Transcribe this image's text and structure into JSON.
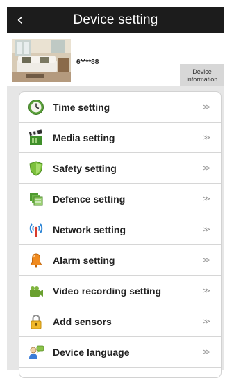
{
  "header": {
    "title": "Device setting",
    "back_glyph": "‹"
  },
  "device": {
    "id": "6****88",
    "info_label_line1": "Device",
    "info_label_line2": "information"
  },
  "menu": {
    "arrow_glyph": "≫",
    "items": [
      {
        "label": "Time setting",
        "icon": "clock-icon"
      },
      {
        "label": "Media setting",
        "icon": "clapperboard-icon"
      },
      {
        "label": "Safety setting",
        "icon": "shield-icon"
      },
      {
        "label": "Defence setting",
        "icon": "defence-icon"
      },
      {
        "label": "Network setting",
        "icon": "antenna-icon"
      },
      {
        "label": "Alarm setting",
        "icon": "bell-icon"
      },
      {
        "label": "Video recording setting",
        "icon": "camera-icon"
      },
      {
        "label": "Add sensors",
        "icon": "lock-icon"
      },
      {
        "label": "Device language",
        "icon": "user-language-icon"
      }
    ]
  },
  "colors": {
    "header_bg": "#1c1c1c",
    "list_bg": "#e6e6e6",
    "info_button_bg": "#d7d7d7"
  }
}
